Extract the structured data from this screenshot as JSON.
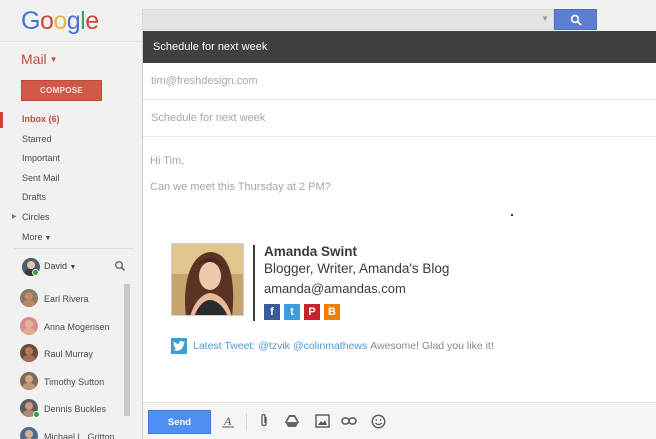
{
  "app": {
    "logo_letters": [
      {
        "ch": "G",
        "color": "#4a6fd3"
      },
      {
        "ch": "o",
        "color": "#d0453b"
      },
      {
        "ch": "o",
        "color": "#e3b83e"
      },
      {
        "ch": "g",
        "color": "#4a6fd3"
      },
      {
        "ch": "l",
        "color": "#3ea35a"
      },
      {
        "ch": "e",
        "color": "#d0453b"
      }
    ],
    "mail_label": "Mail",
    "compose_label": "COMPOSE"
  },
  "nav": [
    {
      "label": "Inbox (6)",
      "active": true,
      "name": "inbox"
    },
    {
      "label": "Starred",
      "name": "starred"
    },
    {
      "label": "Important",
      "name": "important"
    },
    {
      "label": "Sent Mail",
      "name": "sent-mail"
    },
    {
      "label": "Drafts",
      "name": "drafts"
    },
    {
      "label": "Circles",
      "expandable": true,
      "name": "circles"
    },
    {
      "label": "More",
      "dropdown": true,
      "name": "more"
    }
  ],
  "me": {
    "name": "David"
  },
  "contacts": [
    {
      "name": "Earl Rivera",
      "skin": "#c8896a",
      "bg": "#8a7b62",
      "online": false
    },
    {
      "name": "Anna Mogensen",
      "skin": "#e3b39b",
      "bg": "#d98c8c",
      "online": false
    },
    {
      "name": "Raul Murray",
      "skin": "#b77a58",
      "bg": "#6a4c3d",
      "online": false
    },
    {
      "name": "Timothy Sutton",
      "skin": "#d4a585",
      "bg": "#7d6a55",
      "online": false
    },
    {
      "name": "Dennis Buckles",
      "skin": "#c99a7e",
      "bg": "#5d5d5d",
      "online": true
    },
    {
      "name": "Michael L. Gritton",
      "skin": "#d8b091",
      "bg": "#4f6a8a",
      "online": false
    }
  ],
  "compose": {
    "header_title": "Schedule for next week",
    "to_value": "tim@freshdesign.com",
    "subject_value": "Schedule for next week",
    "body_lines": [
      "Hi Tim,",
      "Can we meet this Thursday at 2 PM?"
    ],
    "signature": {
      "name": "Amanda Swint",
      "title": "Blogger, Writer, Amanda's Blog",
      "email": "amanda@amandas.com",
      "social": [
        {
          "network": "facebook-icon",
          "glyph": "f",
          "color": "#3b5a9a"
        },
        {
          "network": "twitter-icon",
          "glyph": "t",
          "color": "#3d9dd8"
        },
        {
          "network": "pinterest-icon",
          "glyph": "P",
          "color": "#c8232c"
        },
        {
          "network": "blogger-icon",
          "glyph": "B",
          "color": "#f57d00"
        }
      ]
    },
    "tweet": {
      "label": "Latest Tweet:",
      "handle1": "@tzvik",
      "handle2": "@colinmathews",
      "text": "Awesome! Glad you like it!"
    },
    "send_label": "Send",
    "toolbar_icons": [
      "formatting-icon",
      "attach-icon",
      "drive-icon",
      "photo-icon",
      "link-icon",
      "emoji-icon"
    ]
  }
}
